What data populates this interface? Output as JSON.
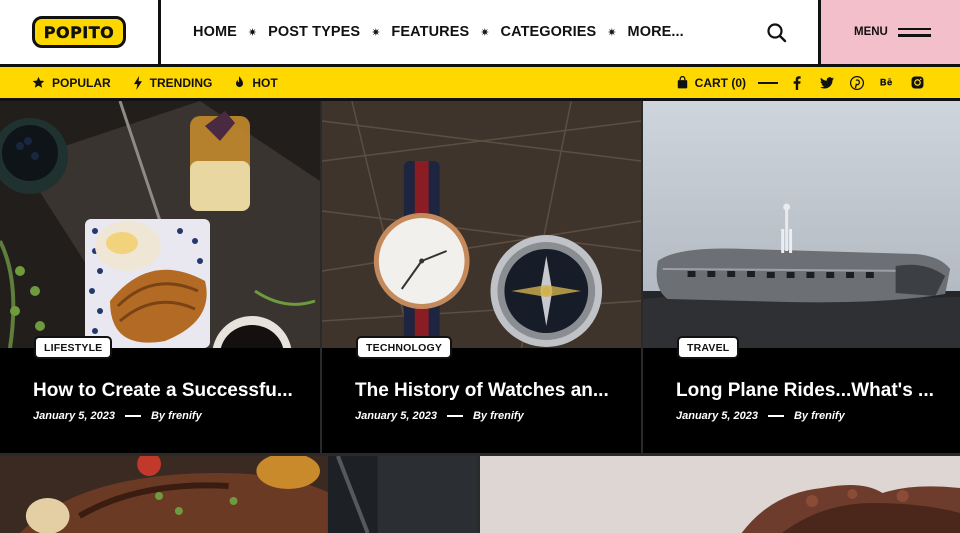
{
  "brand": {
    "logo_text": "POPITO",
    "accent": "#ffd800",
    "menu_bg": "#f2bfca"
  },
  "nav": {
    "items": [
      {
        "label": "HOME"
      },
      {
        "label": "POST TYPES"
      },
      {
        "label": "FEATURES"
      },
      {
        "label": "CATEGORIES"
      },
      {
        "label": "MORE..."
      }
    ],
    "separator": "✷",
    "search_icon": "search-icon",
    "menu_label": "MENU",
    "menu_icon": "hamburger-icon"
  },
  "topbar": {
    "links": [
      {
        "label": "POPULAR",
        "icon": "star-icon"
      },
      {
        "label": "TRENDING",
        "icon": "bolt-icon"
      },
      {
        "label": "HOT",
        "icon": "fire-icon"
      }
    ],
    "cart_label": "CART (0)",
    "socials": [
      {
        "name": "facebook-icon",
        "glyph": "f"
      },
      {
        "name": "twitter-icon",
        "glyph": ""
      },
      {
        "name": "pinterest-icon",
        "glyph": ""
      },
      {
        "name": "behance-icon",
        "glyph": "Bē"
      },
      {
        "name": "instagram-icon",
        "glyph": ""
      }
    ]
  },
  "posts": [
    {
      "category": "LIFESTYLE",
      "title": "How to Create a Successfu...",
      "date": "January 5, 2023",
      "author": "By frenify",
      "image": "breakfast-image"
    },
    {
      "category": "TECHNOLOGY",
      "title": "The History of Watches an...",
      "date": "January 5, 2023",
      "author": "By frenify",
      "image": "watch-compass-image"
    },
    {
      "category": "TRAVEL",
      "title": "Long Plane Rides...What's ...",
      "date": "January 5, 2023",
      "author": "By frenify",
      "image": "plane-wreck-image"
    }
  ],
  "more_posts": [
    {
      "image": "grilled-food-image"
    },
    {
      "image": "rocky-landscape-image"
    }
  ]
}
